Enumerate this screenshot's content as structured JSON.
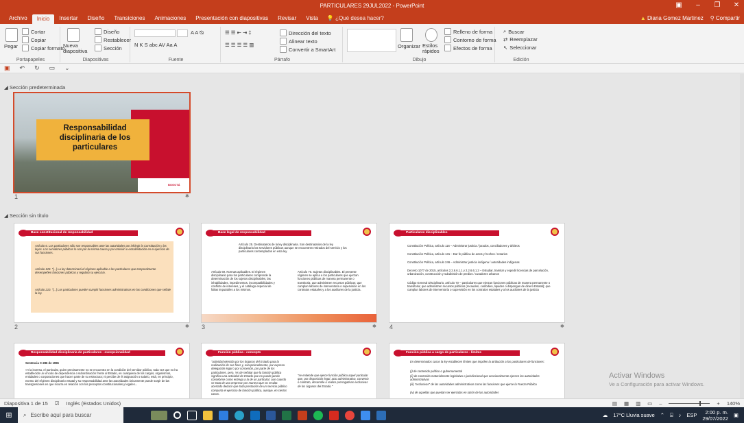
{
  "window": {
    "title": "PARTICULARES 29JUL2022 - PowerPoint",
    "controls": [
      "▣",
      "–",
      "❐",
      "✕"
    ]
  },
  "menu": {
    "tabs": [
      "Archivo",
      "Inicio",
      "Insertar",
      "Diseño",
      "Transiciones",
      "Animaciones",
      "Presentación con diapositivas",
      "Revisar",
      "Vista"
    ],
    "tell_me": "¿Qué desea hacer?",
    "user": "Diana Gomez Martinez",
    "share": "Compartir"
  },
  "ribbon": {
    "portapapeles": {
      "label": "Portapapeles",
      "pegar": "Pegar",
      "cortar": "Cortar",
      "copiar": "Copiar",
      "copiar_formato": "Copiar formato"
    },
    "diapositivas": {
      "label": "Diapositivas",
      "nueva": "Nueva diapositiva",
      "diseno": "Diseño",
      "restablecer": "Restablecer",
      "seccion": "Sección"
    },
    "fuente": {
      "label": "Fuente",
      "format_buttons": "N  K  S  abc  AV  Aa  A"
    },
    "parrafo": {
      "label": "Párrafo",
      "direccion": "Dirección del texto",
      "alinear": "Alinear texto",
      "smartart": "Convertir a SmartArt"
    },
    "dibujo": {
      "label": "Dibujo",
      "organizar": "Organizar",
      "estilos": "Estilos rápidos",
      "relleno": "Relleno de forma",
      "contorno": "Contorno de forma",
      "efectos": "Efectos de forma"
    },
    "edicion": {
      "label": "Edición",
      "buscar": "Buscar",
      "reemplazar": "Reemplazar",
      "seleccionar": "Seleccionar"
    }
  },
  "sections": {
    "first": "Sección predeterminada",
    "second": "Sección sin título"
  },
  "slides": {
    "s1": {
      "num": "1",
      "title": "Responsabilidad disciplinaria de los particulares",
      "brand": "BOGOTÁ"
    },
    "s2": {
      "num": "2",
      "title": "Base constitucional de responsabilidad",
      "p1": "Artículo 6. Los particulares sólo son responsables ante las autoridades por infringir la Constitución y las leyes. Los servidores públicos lo son por la misma causa y por omisión o extralimitación en el ejercicio de sus funciones.",
      "p2": "Artículo 123. \"[...] La ley determinará el régimen aplicable a los particulares que temporalmente desempeñen funciones públicas y regulará su ejercicio.",
      "p3": "Artículo 210. \"[...] Los particulares pueden cumplir funciones administrativas en las condiciones que señale la ley."
    },
    "s3": {
      "num": "3",
      "title": "Base legal de responsabilidad",
      "p1": "Artículo 25. Destinatarios de la ley disciplinaria. Son destinatarios de la ley disciplinaria los servidores públicos aunque se encuentren retirados del servicio y los particulares contemplados en esta ley.",
      "p2": "Artículo 69. Normas aplicables. El régimen disciplinario para los particulares comprende la determinación de los sujetos disciplinables, las inhabilidades, impedimentos, incompatibilidades y conflicto de intereses, y el catálogo especial de faltas imputables a los mismos.",
      "p3": "Artículo 70. Sujetos disciplinables. El presente régimen se aplica a los particulares que ejerzan funciones públicas de manera permanente o transitoria; que administren recursos públicos; que cumplan labores de interventoría o supervisión en los contratos estatales y a los auxiliares de la justicia."
    },
    "s4": {
      "num": "4",
      "title": "Particulares disciplinables",
      "l1": "Constitución Política, artículo 116 – Administrar justicia / jurados, conciliadores y árbitros",
      "l2": "Constitución Política, artículo 131 – Dar fe pública de actos y hechos / notarios",
      "l3": "Constitución Política, artículo 246 – Administrar justicia indígena / autoridades indígenas",
      "l4": "Decreto 1077 de 2015, artículos 2.2.6.6.1.1 y 2.2.6.6.1.2 – Estudiar, tramitar y expedir licencias de parcelación, urbanización, construcción y subdivisión de predios / curadores urbanos",
      "l5": "Código General Disciplinario, artículo 70 – particulares que ejerzan funciones públicas de manera permanente o transitoria; que administren recursos públicos (recauden, custodien, liquiden o dispongan de dinero Estatal); que cumplan labores de interventoría o supervisión en los contratos estatales y a los auxiliares de la justicia"
    },
    "s5": {
      "title": "Responsabilidad disciplinaria de particulares - excepcionalidad",
      "sub": "Sentencia C-286 de 1996",
      "p1": "«A la inversa, el particular, quien precisamente no se encuentra en la condición del servidor público, toda vez que no ha establecido un vínculo de dependencia o subordinación frente al Estado, en cualquiera de los cargos, organismos, entidades o corporaciones que hacen parte de su estructura; ni percibe de él asignación o salario, está, en principio, exento del régimen disciplinario estatal y su responsabilidad ante las autoridades únicamente puede surgir de las transgresiones en que incurra en relación con los preceptos constitucionales y legales..."
    },
    "s6": {
      "title": "Función pública - concepto",
      "p1": "\"actividad ejercida por los órganos del Estado para la realización de sus fines y, excepcionalmente, por expresa delegación legal o por concesión, por parte de los particulares, pero, 'es de señalar que la función pública significa una actividad de Estado que no puede jamás concebirse como entrega a la de un particular; aun cuando se trata de una empresa' por manera que no resulta acertado deducir que toda prestación de un servicio público comporta el ejercicio de función pública, aunque, en ciertos casos.",
      "p2": "\"se entiende que ejerce función pública aquel particular que, por disposición legal, acto administrativo, convenio o contrato, desarrolle o realice prerrogativas exclusivas de los órganos del Estado.\""
    },
    "s7": {
      "title": "Función pública a cargo de particulares - límites",
      "p1": "En determinados casos la ley establecen límites que impiden la atribución a los particulares de funciones:",
      "l1": "(i) de contenido político o gubernamental",
      "l2": "(ii) de contenido materialmente legislativo o jurisdiccional que ocasionalmente ejercen las autoridades administrativas",
      "l3": "(iii) \"exclusivas\" de las autoridades administrativas como las funciones que ejerce la Fuerza Pública",
      "l4": "(iv) de aquellas que puedan ser ejercidas en razón de las autoridades"
    }
  },
  "activate": {
    "line1": "Activar Windows",
    "line2": "Ve a Configuración para activar Windows."
  },
  "status": {
    "slide_info": "Diapositiva 1 de 15",
    "language": "Inglés (Estados Unidos)",
    "zoom": "140%"
  },
  "taskbar": {
    "search_placeholder": "Escribe aquí para buscar",
    "weather": "17°C Lluvia suave",
    "lang": "ESP",
    "time": "2:00 p. m.",
    "date": "29/07/2022"
  },
  "colors": {
    "accent": "#c43e1c",
    "slide_red": "#c8102e",
    "slide_gold": "#f0b23c"
  }
}
